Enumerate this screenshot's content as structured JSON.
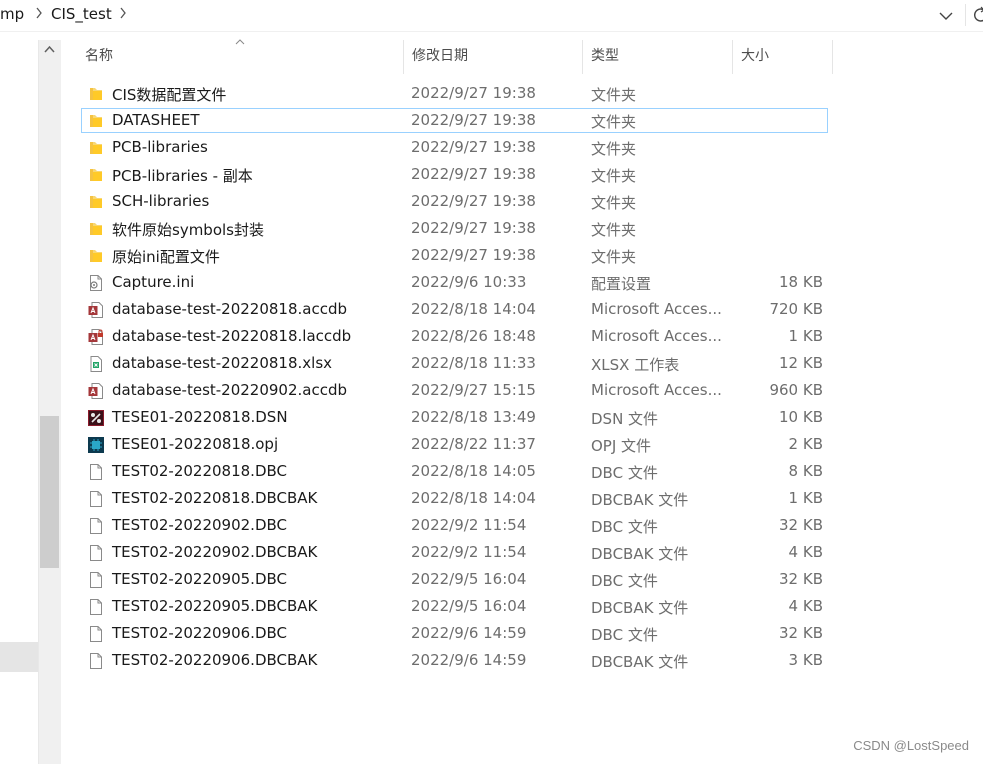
{
  "breadcrumb": {
    "segments": [
      "mp",
      "CIS_test"
    ]
  },
  "columns": {
    "name": "名称",
    "date": "修改日期",
    "type": "类型",
    "size": "大小"
  },
  "files": [
    {
      "name": "CIS数据配置文件",
      "date": "2022/9/27 19:38",
      "type": "文件夹",
      "size": "",
      "icon": "folder-icon"
    },
    {
      "name": "DATASHEET",
      "date": "2022/9/27 19:38",
      "type": "文件夹",
      "size": "",
      "icon": "folder-icon",
      "selected": true
    },
    {
      "name": "PCB-libraries",
      "date": "2022/9/27 19:38",
      "type": "文件夹",
      "size": "",
      "icon": "folder-icon"
    },
    {
      "name": "PCB-libraries - 副本",
      "date": "2022/9/27 19:38",
      "type": "文件夹",
      "size": "",
      "icon": "folder-icon"
    },
    {
      "name": "SCH-libraries",
      "date": "2022/9/27 19:38",
      "type": "文件夹",
      "size": "",
      "icon": "folder-icon"
    },
    {
      "name": "软件原始symbols封装",
      "date": "2022/9/27 19:38",
      "type": "文件夹",
      "size": "",
      "icon": "folder-icon"
    },
    {
      "name": "原始ini配置文件",
      "date": "2022/9/27 19:38",
      "type": "文件夹",
      "size": "",
      "icon": "folder-icon"
    },
    {
      "name": "Capture.ini",
      "date": "2022/9/6 10:33",
      "type": "配置设置",
      "size": "18 KB",
      "icon": "ini-file-icon"
    },
    {
      "name": "database-test-20220818.accdb",
      "date": "2022/8/18 14:04",
      "type": "Microsoft Acces...",
      "size": "720 KB",
      "icon": "access-database-icon"
    },
    {
      "name": "database-test-20220818.laccdb",
      "date": "2022/8/26 18:48",
      "type": "Microsoft Acces...",
      "size": "1 KB",
      "icon": "access-lock-icon"
    },
    {
      "name": "database-test-20220818.xlsx",
      "date": "2022/8/18 11:33",
      "type": "XLSX 工作表",
      "size": "12 KB",
      "icon": "xlsx-file-icon"
    },
    {
      "name": "database-test-20220902.accdb",
      "date": "2022/9/27 15:15",
      "type": "Microsoft Acces...",
      "size": "960 KB",
      "icon": "access-database-icon"
    },
    {
      "name": "TESE01-20220818.DSN",
      "date": "2022/8/18 13:49",
      "type": "DSN 文件",
      "size": "10 KB",
      "icon": "dsn-file-icon"
    },
    {
      "name": "TESE01-20220818.opj",
      "date": "2022/8/22 11:37",
      "type": "OPJ 文件",
      "size": "2 KB",
      "icon": "opj-file-icon"
    },
    {
      "name": "TEST02-20220818.DBC",
      "date": "2022/8/18 14:05",
      "type": "DBC 文件",
      "size": "8 KB",
      "icon": "blank-file-icon"
    },
    {
      "name": "TEST02-20220818.DBCBAK",
      "date": "2022/8/18 14:04",
      "type": "DBCBAK 文件",
      "size": "1 KB",
      "icon": "blank-file-icon"
    },
    {
      "name": "TEST02-20220902.DBC",
      "date": "2022/9/2 11:54",
      "type": "DBC 文件",
      "size": "32 KB",
      "icon": "blank-file-icon"
    },
    {
      "name": "TEST02-20220902.DBCBAK",
      "date": "2022/9/2 11:54",
      "type": "DBCBAK 文件",
      "size": "4 KB",
      "icon": "blank-file-icon"
    },
    {
      "name": "TEST02-20220905.DBC",
      "date": "2022/9/5 16:04",
      "type": "DBC 文件",
      "size": "32 KB",
      "icon": "blank-file-icon"
    },
    {
      "name": "TEST02-20220905.DBCBAK",
      "date": "2022/9/5 16:04",
      "type": "DBCBAK 文件",
      "size": "4 KB",
      "icon": "blank-file-icon"
    },
    {
      "name": "TEST02-20220906.DBC",
      "date": "2022/9/6 14:59",
      "type": "DBC 文件",
      "size": "32 KB",
      "icon": "blank-file-icon"
    },
    {
      "name": "TEST02-20220906.DBCBAK",
      "date": "2022/9/6 14:59",
      "type": "DBCBAK 文件",
      "size": "3 KB",
      "icon": "blank-file-icon"
    }
  ],
  "watermark": "CSDN @LostSpeed",
  "colors": {
    "selection_border": "#99d1ff",
    "folder": "#f8d775",
    "access_red": "#a4373a",
    "excel_green": "#21a366"
  }
}
